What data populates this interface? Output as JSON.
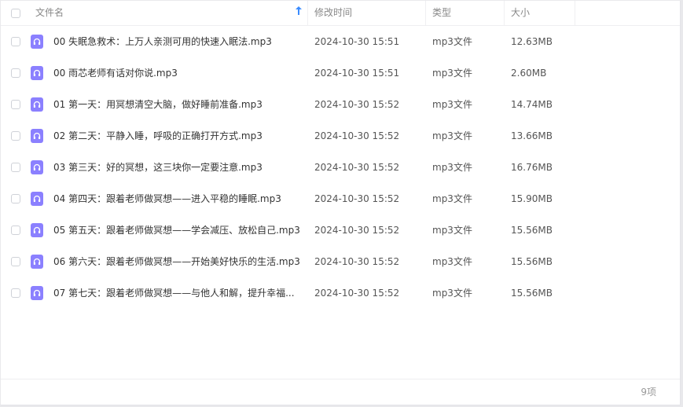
{
  "header": {
    "col_name": "文件名",
    "col_modified": "修改时间",
    "col_type": "类型",
    "col_size": "大小",
    "sort_icon": "sort-up-icon"
  },
  "colors": {
    "accent": "#3b8cff",
    "audio_icon": "#8b80ff"
  },
  "files": [
    {
      "name": "00 失眠急救术：上万人亲测可用的快速入眠法.mp3",
      "modified": "2024-10-30 15:51",
      "type": "mp3文件",
      "size": "12.63MB"
    },
    {
      "name": "00 雨芯老师有话对你说.mp3",
      "modified": "2024-10-30 15:51",
      "type": "mp3文件",
      "size": "2.60MB"
    },
    {
      "name": "01 第一天：用冥想清空大脑，做好睡前准备.mp3",
      "modified": "2024-10-30 15:52",
      "type": "mp3文件",
      "size": "14.74MB"
    },
    {
      "name": "02 第二天：平静入睡，呼吸的正确打开方式.mp3",
      "modified": "2024-10-30 15:52",
      "type": "mp3文件",
      "size": "13.66MB"
    },
    {
      "name": "03 第三天：好的冥想，这三块你一定要注意.mp3",
      "modified": "2024-10-30 15:52",
      "type": "mp3文件",
      "size": "16.76MB"
    },
    {
      "name": "04 第四天：跟着老师做冥想——进入平稳的睡眠.mp3",
      "modified": "2024-10-30 15:52",
      "type": "mp3文件",
      "size": "15.90MB"
    },
    {
      "name": "05 第五天：跟着老师做冥想——学会减压、放松自己.mp3",
      "modified": "2024-10-30 15:52",
      "type": "mp3文件",
      "size": "15.56MB"
    },
    {
      "name": "06 第六天：跟着老师做冥想——开始美好快乐的生活.mp3",
      "modified": "2024-10-30 15:52",
      "type": "mp3文件",
      "size": "15.56MB"
    },
    {
      "name": "07 第七天：跟着老师做冥想——与他人和解，提升幸福...",
      "modified": "2024-10-30 15:52",
      "type": "mp3文件",
      "size": "15.56MB"
    }
  ],
  "footer": {
    "count": "9项"
  }
}
